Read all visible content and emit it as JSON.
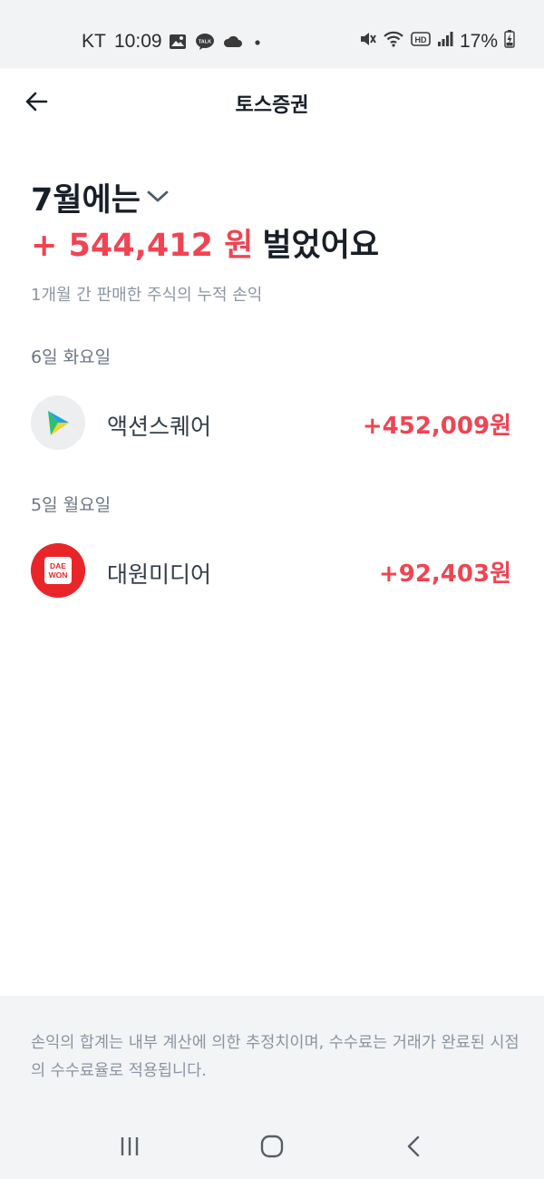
{
  "status_bar": {
    "carrier": "KT",
    "time": "10:09",
    "battery_percent": "17%",
    "left_icons": [
      "gallery-icon",
      "kakaotalk-icon",
      "cloud-icon",
      "dot-icon"
    ],
    "right_icons": [
      "mute-vibrate-icon",
      "wifi-icon",
      "hd-icon",
      "signal-icon",
      "battery-charging-icon"
    ]
  },
  "header": {
    "title": "토스증권",
    "back_icon": "arrow-left-icon"
  },
  "summary": {
    "month_label": "7월에는",
    "month_dropdown_icon": "chevron-down-icon",
    "profit_amount": "+ 544,412 원",
    "profit_suffix": "벌었어요",
    "description": "1개월 간 판매한 주식의 누적 손익"
  },
  "groups": [
    {
      "date": "6일 화요일",
      "items": [
        {
          "name": "액션스퀘어",
          "profit": "+452,009원",
          "logo_icon": "actionsquare-logo-icon"
        }
      ]
    },
    {
      "date": "5일 월요일",
      "items": [
        {
          "name": "대원미디어",
          "profit": "+92,403원",
          "logo_icon": "daewon-logo-icon",
          "logo_text_top": "DAE",
          "logo_text_bottom": "WON"
        }
      ]
    }
  ],
  "footer": {
    "note": "손익의 합계는 내부 계산에 의한 추정치이며, 수수료는 거래가 완료된 시점의 수수료율로 적용됩니다."
  },
  "nav_bar": {
    "buttons": [
      "recent-apps-icon",
      "home-icon",
      "back-icon"
    ]
  },
  "colors": {
    "profit_red": "#f04452",
    "text_dark": "#191f28",
    "text_gray": "#8b95a1",
    "footer_bg": "#f2f4f6",
    "daewon_red": "#e8262a"
  }
}
